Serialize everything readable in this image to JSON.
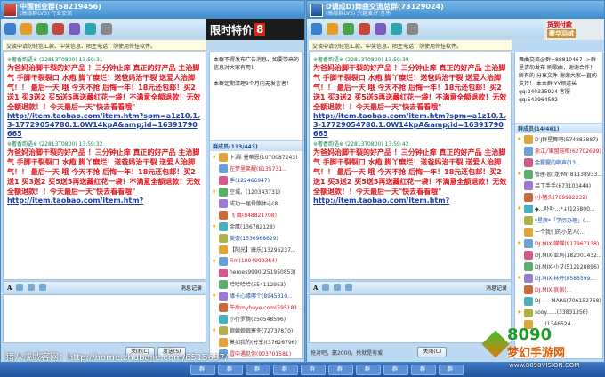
{
  "windows": [
    {
      "title": "中国创业群(58219456)",
      "subtitle": "(高级群LV3) 行业交流",
      "ad_text": "限时特价",
      "ad_num": "8",
      "notice": "交谈中请勿轻信汇款、中奖信息、陌生电话，勿使用外挂软件。",
      "messages": [
        {
          "sender": "※奢香韵语※ (22813T0800)  13:59:31",
          "text": "为爸妈治脚干裂的好产品 ！三分钟止痒 真正的好产品 主治脚气 手脚干裂裂口 水疱 脚丫糜烂！送爸妈治干裂 送爱人治脚气！！ 最后一天 哦 今天不抢 后悔一年！18元还包邮！买2送1 买3送2 买5送5再送藏红花一袋！不满意全额退款！无效全额退款！！今天最后一天\"快去看看哦\"",
          "link": "http://item.taobao.com/item.htm?spm=a1z10.1.3-17729054780.1.0W14kpA&amp;id=16391790665"
        },
        {
          "sender": "※奢香韵语※ (22813T0800)  13:59:32",
          "text": "为爸妈治脚干裂的好产品 ！三分钟止痒 真正的好产品 主治脚气 手脚干裂裂口 水疱 脚丫糜烂！送爸妈治干裂 送爱人治脚气！！ 最后一天 哦 今天不抢 后悔一年！18元还包邮！买2送1 买3送2 买5送5再送藏红花一袋！不满意全额退款！无效全额退款！！今天最后一天\"快去看看哦\"",
          "link": "http://item.taobao.com/item.htm?"
        }
      ],
      "font_tool": "消息记录",
      "close_btn": "关闭(C)",
      "send_btn": "发送(S)",
      "announcement": "本群不得发布广告消息，如要带来的信息对大家有用！\n\n本群定期清理3个月内无发言者！",
      "member_header": "群成员(113/443)",
      "members": [
        "卜湖i 曼蒂恩(1070087243)",
        "在梦里笑醒(8135731...",
        "手(122466947)",
        "空城。(120343731)",
        "成功一届骨骼体心(8..",
        "飞 鹰(848821708)",
        "金鹰(136782128)",
        "美奈(1536968629)",
        "【阳光】康乐(13296237...",
        "Fim(1004999364)",
        "heroes9990(251950853)",
        "哈哈哈哈(554112953)",
        "緣卡心缘哪个(8945810...",
        "午后myhuye.com(595181...",
        "小行罗腾(250548596)",
        "娘娘娘娘寒冬(72737870)",
        "莫如我的(分享)(37626796)",
        "雪中遇见你(903701581)",
        "杀虫/杀蛊(80083601..."
      ]
    },
    {
      "title": "D调成D)舞曲交流总群(73129024)",
      "subtitle": "(高级群LV3) 兴趣爱好:音乐",
      "ad_text": "货到付款",
      "ad_sub": "奢华羽绒",
      "notice": "交谈中请勿轻信汇款、中奖信息、陌生电话，勿使用外挂软件。",
      "messages": [
        {
          "sender": "※奢香韵语※ (22813T0800)  13:59:39",
          "text": "为爸妈治脚干裂的好产品 ！三分钟止痒 真正的好产品 主治脚气 手脚干裂裂口 水疱 脚丫糜烂！送爸妈治干裂 送爱人治脚气！！ 最后一天 哦 今天不抢 后悔一年！18元还包邮！买2送1 买3送2 买5送5再送藏红花一袋！不满意全额退款！无效全额退款！！今天最后一天\"快去看看哦\"",
          "link": "http://item.taobao.com/item.htm?spm=a1z10.1.3-17729054780.1.0W14kpA&amp;id=16391790665"
        },
        {
          "sender": "※奢香韵语※ (22813T0800)  13:59:42",
          "text": "为爸妈治脚干裂的好产品 ！三分钟止痒 真正的好产品 主治脚气 手脚干裂裂口 水疱 脚丫糜烂！送爸妈治干裂 送爱人治脚气！！ 最后一天 哦 今天不抢 后悔一年！18元还包邮！买2送1 买3送2 买5送5再送藏红花一袋！不满意全额退款！无效全额退款！！今天最后一天\"快去看看哦\"",
          "link": "http://item.taobao.com/item.htm?"
        }
      ],
      "font_tool": "消息记录",
      "close_btn": "关闭(C)",
      "status": "抢对吧，赢2000，抢就是有爱",
      "announcement": "舞曲交流@群=88810467-->群里请勿发布 刷歌曲，谢谢合作！ 所有的 分享文件 谢谢大家一直的支持！ 本本群 YY频道长qq:240335924 客服qq:543964592",
      "member_header": "群成员(14/461)",
      "members": [
        "D J群星舞吧(574883887)",
        "浙江╱果盟鞋柜(62702699)",
        "金猩猩的哨声(13...",
        "管理-欧·龙·Mr(81138933...",
        "吕丁手手(673103444)",
        "(小猪头(769992232)",
        "◆…卟卟…*↓(125800...",
        "*星旗*「学历办理」(...",
        "一个我们的小兄人(...",
        "DJ.MIX-蝶蝶(917967138)",
        "DJ.MIX-亚玛(182001432...",
        "DJ.MIX-小艾(512120896)",
        "DJ.MIX-林丹(8586599...",
        "DJ.MIX-哀佩(...",
        "DJ——MARS(706152768)",
        "sooy......(33831356)",
        "......(1346524..."
      ]
    }
  ],
  "watermark": "猪八戒威客网：http://home.zhubajie.com/6515637/",
  "logo": {
    "big": "8090",
    "mid": "梦幻手游网",
    "url": "www.8090VISION.COM"
  },
  "taskbar": [
    "群",
    "群",
    "群",
    "群",
    "群",
    "群",
    "群",
    "群",
    "群",
    "群"
  ]
}
